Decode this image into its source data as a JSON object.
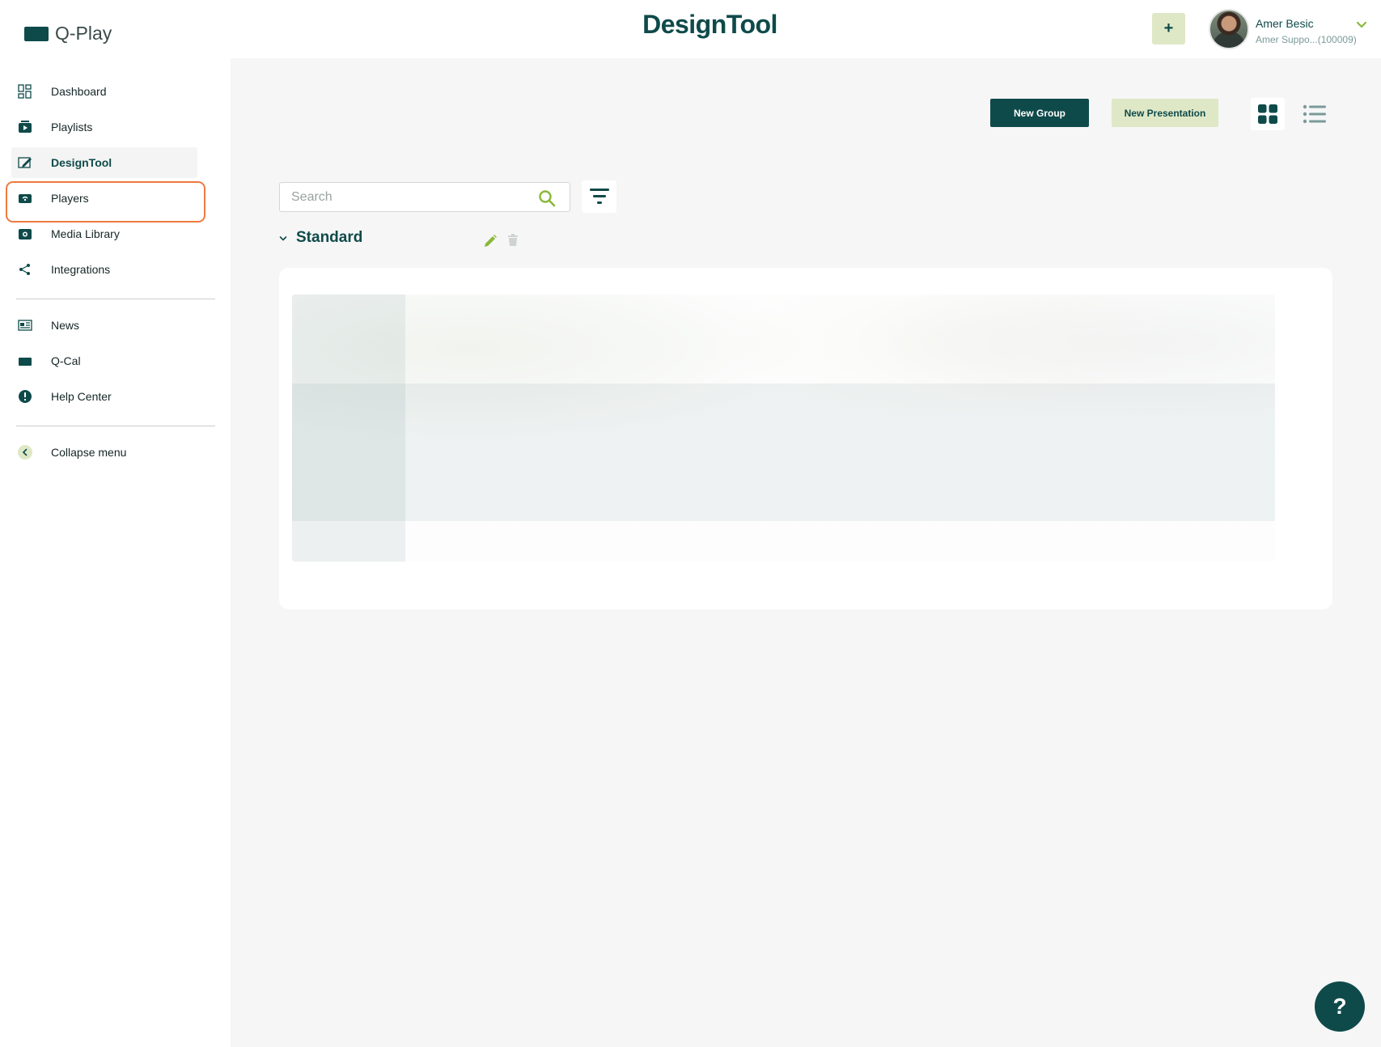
{
  "brand": {
    "name": "Q-Play"
  },
  "header": {
    "title": "DesignTool",
    "add_label": "+",
    "user_name": "Amer Besic",
    "user_sub": "Amer Suppo...(100009)"
  },
  "sidebar": {
    "items": [
      {
        "label": "Dashboard",
        "icon": "dashboard-icon"
      },
      {
        "label": "Playlists",
        "icon": "playlist-icon"
      },
      {
        "label": "DesignTool",
        "icon": "design-tool-icon",
        "active": true
      },
      {
        "label": "Players",
        "icon": "player-icon",
        "highlighted": true
      },
      {
        "label": "Media Library",
        "icon": "media-library-icon"
      },
      {
        "label": "Integrations",
        "icon": "integrations-icon"
      }
    ],
    "secondary": [
      {
        "label": "News",
        "icon": "news-icon"
      },
      {
        "label": "Q-Cal",
        "icon": "qcal-icon"
      },
      {
        "label": "Help Center",
        "icon": "help-center-icon"
      }
    ],
    "collapse_label": "Collapse menu"
  },
  "toolbar": {
    "new_group_label": "New Group",
    "new_presentation_label": "New Presentation",
    "view_mode": "grid"
  },
  "search": {
    "placeholder": "Search",
    "value": ""
  },
  "group": {
    "title": "Standard",
    "expanded": true
  },
  "help_fab": {
    "label": "?"
  },
  "colors": {
    "primary": "#0f4a4a",
    "accent": "#dfe8c6",
    "highlight": "#ee7a3f",
    "edit": "#8ab83a"
  }
}
